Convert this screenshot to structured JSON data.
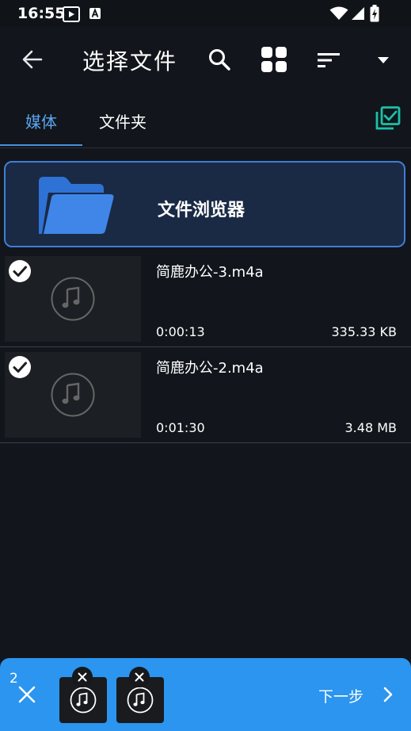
{
  "status": {
    "time": "16:55"
  },
  "header": {
    "title": "选择文件"
  },
  "tabs": [
    "媒体",
    "文件夹"
  ],
  "browser": {
    "label": "文件浏览器"
  },
  "files": [
    {
      "name": "简鹿办公-3.m4a",
      "duration": "0:00:13",
      "size": "335.33 KB"
    },
    {
      "name": "简鹿办公-2.m4a",
      "duration": "0:01:30",
      "size": "3.48 MB"
    }
  ],
  "bottom": {
    "count": "2",
    "next_label": "下一步"
  },
  "colors": {
    "accent": "#2b95ef",
    "folder": "#3d7fd6",
    "multi": "#19c1a8"
  }
}
